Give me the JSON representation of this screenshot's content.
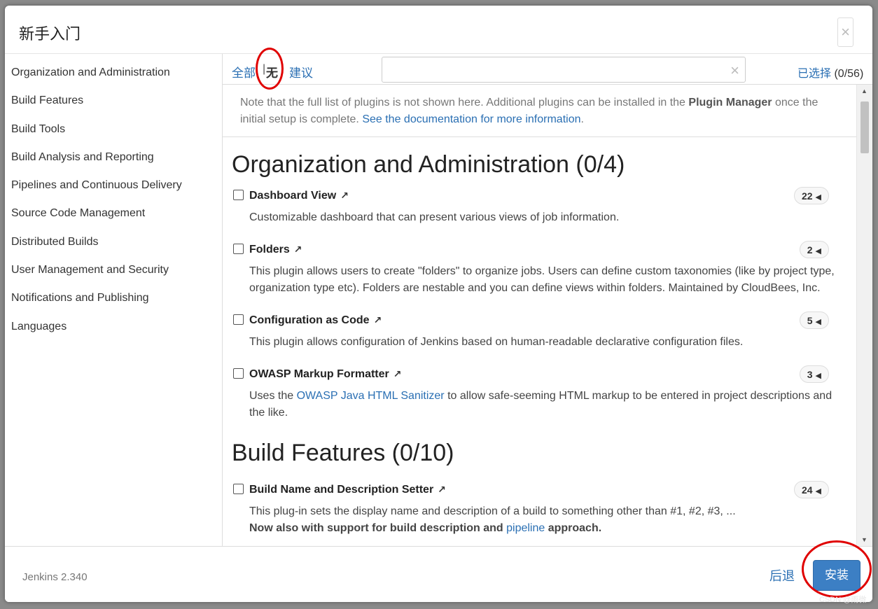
{
  "dialog": {
    "title": "新手入门",
    "close_glyph": "×"
  },
  "sidebar": {
    "items": [
      {
        "label": "Organization and Administration"
      },
      {
        "label": "Build Features"
      },
      {
        "label": "Build Tools"
      },
      {
        "label": "Build Analysis and Reporting"
      },
      {
        "label": "Pipelines and Continuous Delivery"
      },
      {
        "label": "Source Code Management"
      },
      {
        "label": "Distributed Builds"
      },
      {
        "label": "User Management and Security"
      },
      {
        "label": "Notifications and Publishing"
      },
      {
        "label": "Languages"
      }
    ]
  },
  "toolbar": {
    "filter_all": "全部",
    "separator": "|",
    "filter_none": "无",
    "filter_suggested": "建议",
    "search_value": "",
    "search_clear_glyph": "×",
    "selected_label": "已选择",
    "selected_count": "(0/56)"
  },
  "note": {
    "text_before": "Note that the full list of plugins is not shown here. Additional plugins can be installed in the ",
    "strong": "Plugin Manager",
    "text_after": " once the initial setup is complete. ",
    "link": "See the documentation for more information",
    "period": "."
  },
  "sections": [
    {
      "title": "Organization and Administration (0/4)",
      "plugins": [
        {
          "name": "Dashboard View",
          "ext": "↗",
          "count": "22",
          "desc": "Customizable dashboard that can present various views of job information."
        },
        {
          "name": "Folders",
          "ext": "↗",
          "count": "2",
          "desc": "This plugin allows users to create \"folders\" to organize jobs. Users can define custom taxonomies (like by project type, organization type etc). Folders are nestable and you can define views within folders. Maintained by CloudBees, Inc."
        },
        {
          "name": "Configuration as Code",
          "ext": "↗",
          "count": "5",
          "desc": "This plugin allows configuration of Jenkins based on human-readable declarative configuration files."
        },
        {
          "name": "OWASP Markup Formatter",
          "ext": "↗",
          "count": "3",
          "desc_before": "Uses the ",
          "desc_link": "OWASP Java HTML Sanitizer",
          "desc_after": " to allow safe-seeming HTML markup to be entered in project descriptions and the like."
        }
      ]
    },
    {
      "title": "Build Features (0/10)",
      "plugins": [
        {
          "name": "Build Name and Description Setter",
          "ext": "↗",
          "count": "24",
          "desc_line1": "This plug-in sets the display name and description of a build to something other than #1, #2, #3, ...",
          "desc_bold": "Now also with support for build description and ",
          "desc_link": "pipeline",
          "desc_bold_after": " approach."
        }
      ]
    }
  ],
  "footer": {
    "version": "Jenkins 2.340",
    "back_label": "后退",
    "install_label": "安装"
  },
  "watermark": "CSDN @雨微",
  "colors": {
    "link": "#2a6fb3",
    "primary_button": "#3c7fc4",
    "annotation_circle": "#e00000"
  }
}
